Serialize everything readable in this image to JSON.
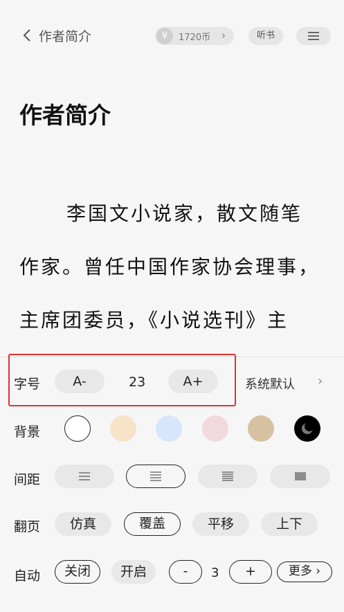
{
  "header": {
    "back_icon": "chevron-left-icon",
    "title": "作者简介",
    "coin_icon": "¥",
    "coins": "1720币",
    "coin_chevron": "›",
    "listen_label": "听书",
    "menu_icon": "menu-icon"
  },
  "content": {
    "title": "作者简介",
    "lines": [
      "李国文小说家，散文随笔",
      "作家。曾任中国作家协会理事，",
      "主席团委员，《小说选刊》主"
    ]
  },
  "settings": {
    "font_size": {
      "label": "字号",
      "decrease": "A-",
      "value": "23",
      "increase": "A+",
      "font_name": "系统默认",
      "chevron": "›"
    },
    "background": {
      "label": "背景",
      "colors": [
        "#ffffff",
        "#f7e3c7",
        "#d6e6fb",
        "#f1d9dd",
        "#d6c2a2",
        "#000000"
      ],
      "selected_index": 0
    },
    "spacing": {
      "label": "间距",
      "options": 4,
      "selected_index": 1
    },
    "page_turn": {
      "label": "翻页",
      "options": [
        "仿真",
        "覆盖",
        "平移",
        "上下"
      ],
      "selected_index": 1
    },
    "auto": {
      "label": "自动",
      "off": "关闭",
      "on": "开启",
      "minus": "-",
      "speed": "3",
      "plus": "+",
      "more": "更多",
      "more_chevron": "›"
    }
  }
}
